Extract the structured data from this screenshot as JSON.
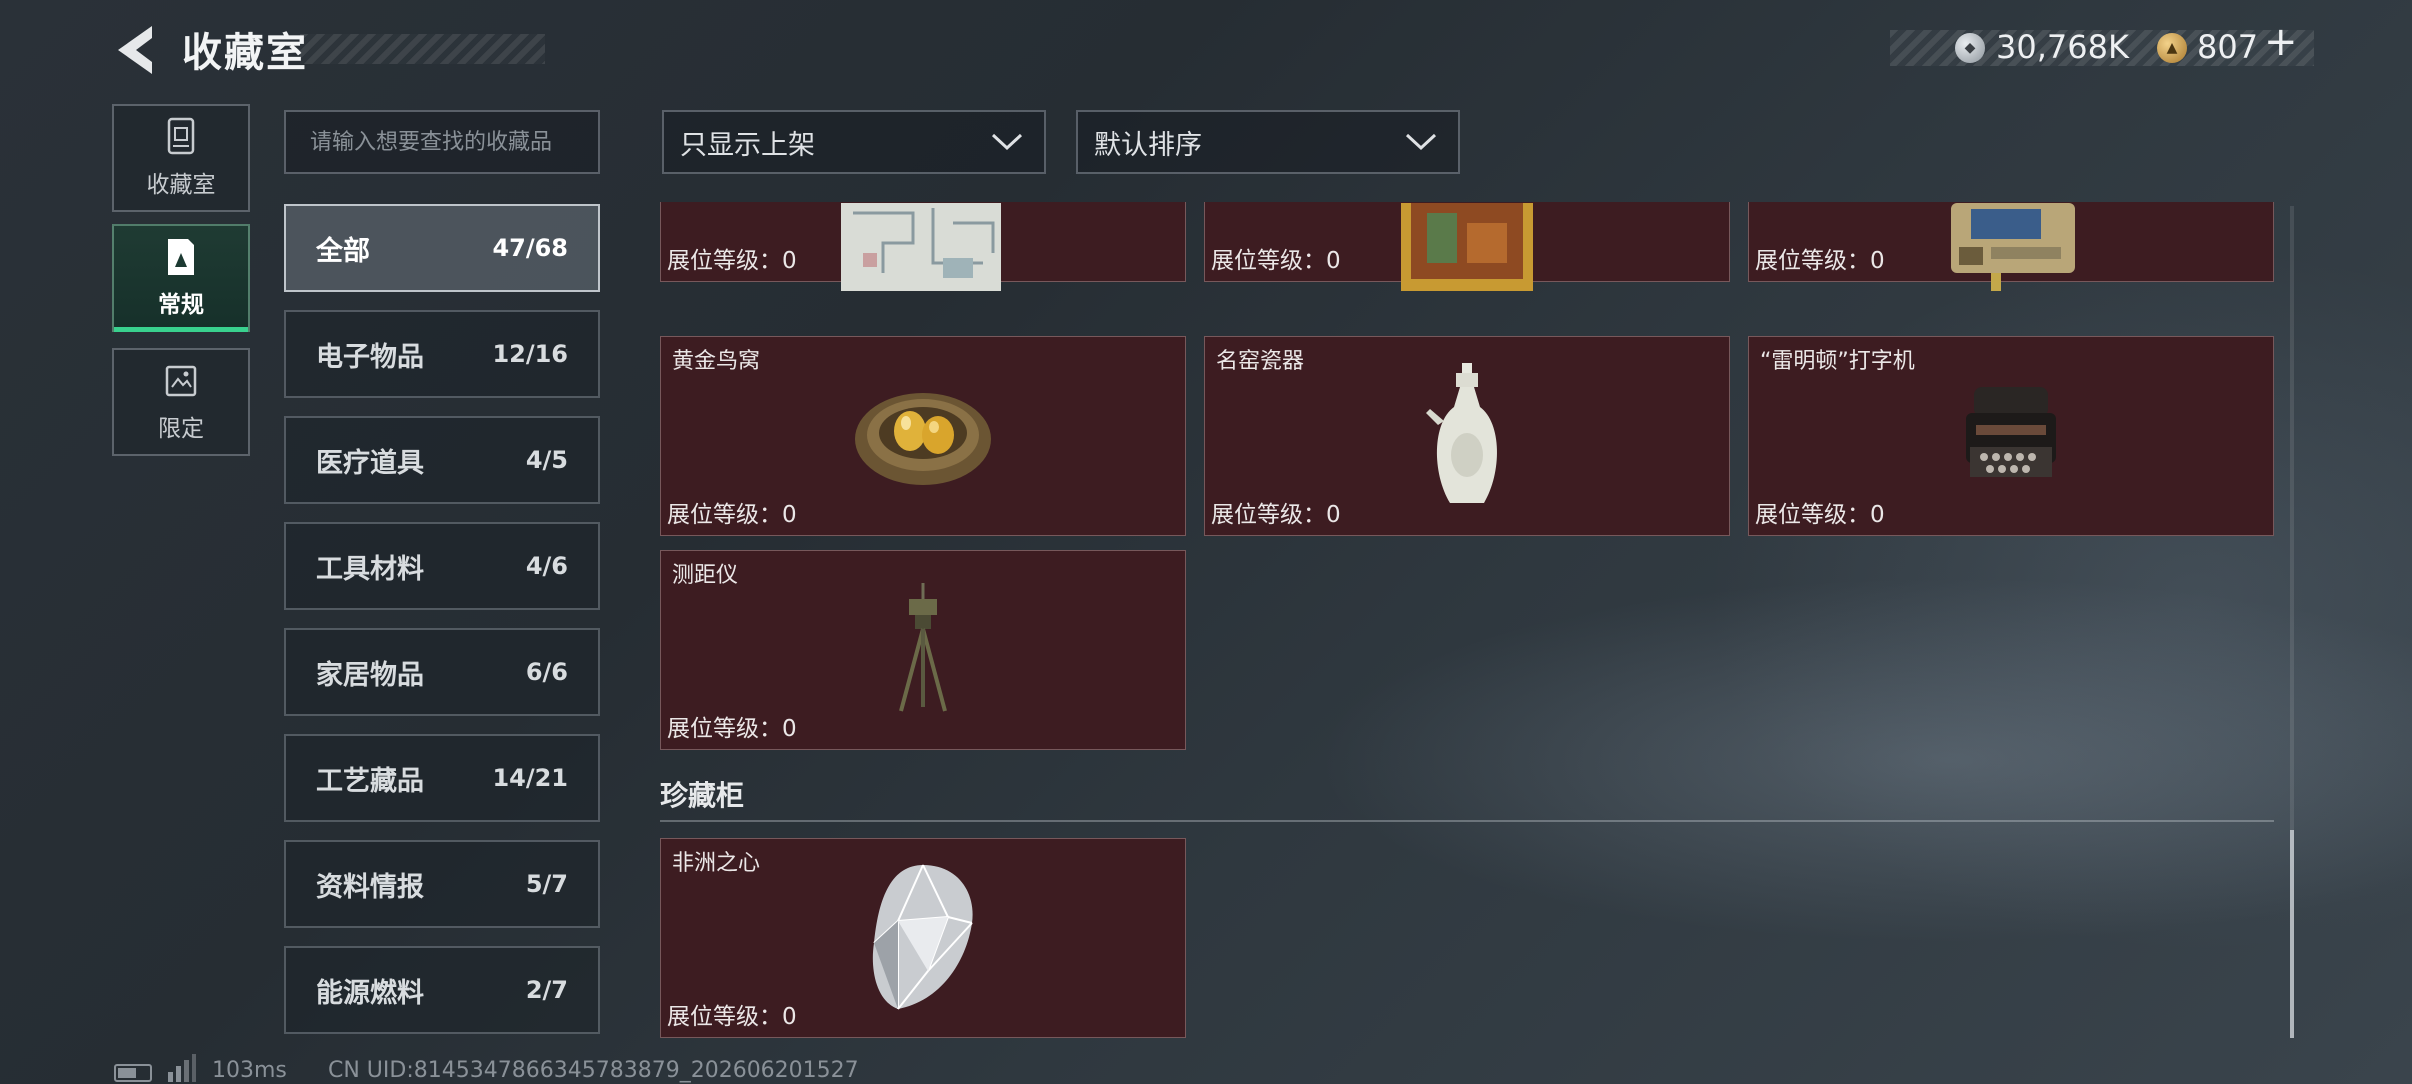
{
  "header": {
    "title": "收藏室",
    "back_icon": "back-arrow-icon",
    "currency1": {
      "icon": "silver-coin-icon",
      "value": "30,768K"
    },
    "currency2": {
      "icon": "gold-coin-icon",
      "value": "807"
    },
    "add_label": "+"
  },
  "modes": [
    {
      "label": "收藏室",
      "icon": "cabinet-icon"
    },
    {
      "label": "常规",
      "icon": "card-icon",
      "active": true
    },
    {
      "label": "限定",
      "icon": "frame-icon"
    }
  ],
  "search": {
    "placeholder": "请输入想要查找的收藏品"
  },
  "categories": [
    {
      "name": "全部",
      "count": "47/68",
      "active": true
    },
    {
      "name": "电子物品",
      "count": "12/16"
    },
    {
      "name": "医疗道具",
      "count": "4/5"
    },
    {
      "name": "工具材料",
      "count": "4/6"
    },
    {
      "name": "家居物品",
      "count": "6/6"
    },
    {
      "name": "工艺藏品",
      "count": "14/21"
    },
    {
      "name": "资料情报",
      "count": "5/7"
    },
    {
      "name": "能源燃料",
      "count": "2/7"
    }
  ],
  "filters": {
    "display": "只显示上架",
    "sort": "默认排序"
  },
  "items": [
    {
      "name": "",
      "level": "展位等级：0",
      "image": "map-icon"
    },
    {
      "name": "",
      "level": "展位等级：0",
      "image": "painting-icon"
    },
    {
      "name": "",
      "level": "展位等级：0",
      "image": "device-icon"
    },
    {
      "name": "黄金鸟窝",
      "level": "展位等级：0",
      "image": "golden-nest-icon"
    },
    {
      "name": "名窑瓷器",
      "level": "展位等级：0",
      "image": "porcelain-vase-icon"
    },
    {
      "name": "“雷明顿”打字机",
      "level": "展位等级：0",
      "image": "typewriter-icon"
    },
    {
      "name": "测距仪",
      "level": "展位等级：0",
      "image": "rangefinder-icon"
    }
  ],
  "treasure_section": {
    "title": "珍藏柜",
    "items": [
      {
        "name": "非洲之心",
        "level": "展位等级：0",
        "image": "diamond-icon"
      }
    ]
  },
  "footer": {
    "ping": "103ms",
    "uid": "CN UID:8145347866345783879_202606201527"
  }
}
